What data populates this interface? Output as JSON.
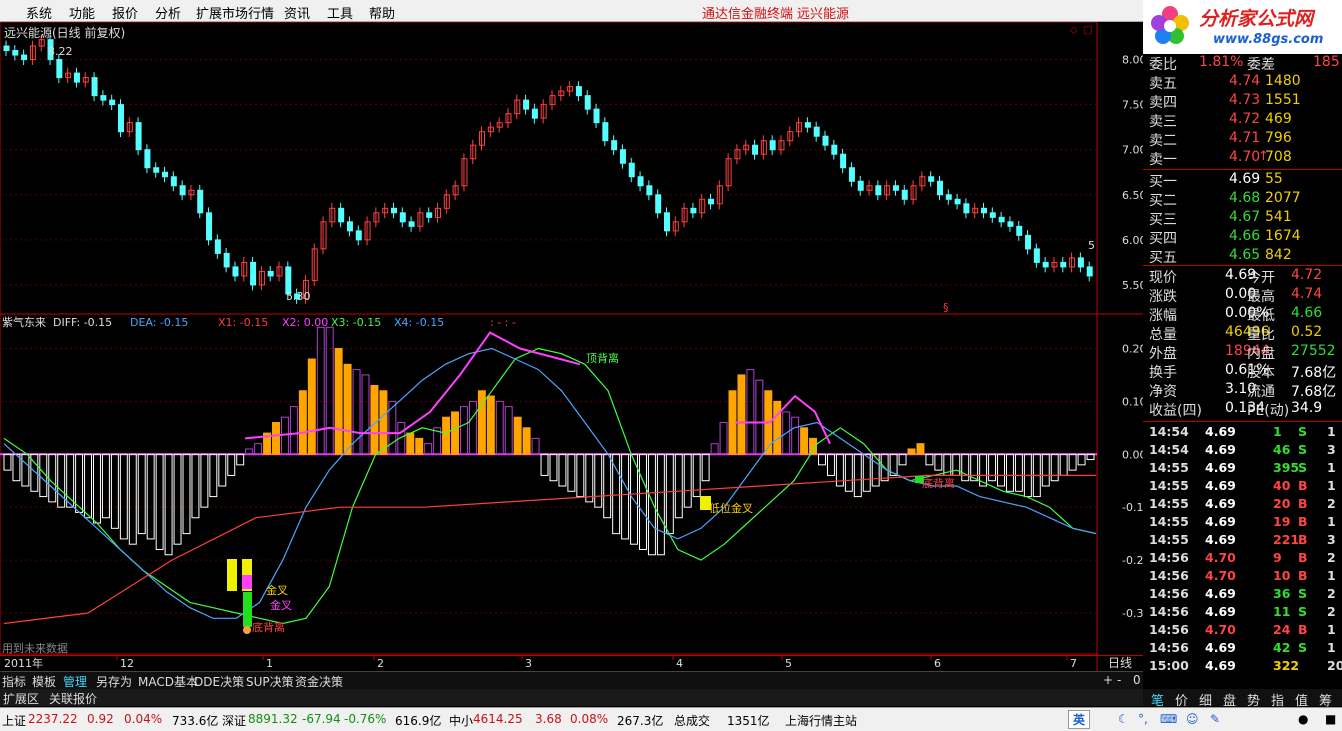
{
  "menu": {
    "items": [
      "系统",
      "功能",
      "报价",
      "分析",
      "扩展市场行情",
      "资讯",
      "工具",
      "帮助"
    ],
    "brand": "通达信金融终端",
    "stock": "远兴能源"
  },
  "logo": {
    "title": "分析家公式网",
    "url": "www.88gs.com"
  },
  "price_panel": {
    "title": "远兴能源(日线 前复权)",
    "high_label": "8.22",
    "low_label": "5.30",
    "y_ticks": [
      "8.00",
      "7.50",
      "7.00",
      "6.50",
      "6.00",
      "5.50"
    ],
    "y_range": [
      5.2,
      8.35
    ],
    "last_mark": "5"
  },
  "indicator_panel": {
    "name": "紫气东来",
    "diff": "DIFF: -0.15",
    "dea": "DEA: -0.15",
    "x1": "X1: -0.15",
    "x2": "X2: 0.00",
    "x3": "X3: -0.15",
    "x4": "X4: -0.15",
    "extra": ": -  : -",
    "y_ticks": [
      "0.20",
      "0.10",
      "0.00",
      "-0.10",
      "-0.20",
      "-0.30"
    ],
    "y_range": [
      -0.37,
      0.25
    ],
    "annotations": {
      "top_div": "顶背离",
      "low_cross": "低位金叉",
      "bottom_div1": "底背离",
      "bottom_div2": "底背离",
      "cross_a": "金叉",
      "cross_b": "金叉",
      "cross_c": "金叉",
      "future": "用到未来数据"
    }
  },
  "timeline": {
    "labels": [
      "2011年",
      "12",
      "1",
      "2",
      "3",
      "4",
      "5",
      "6",
      "7"
    ],
    "period": "日线",
    "zoom": "0"
  },
  "quote": {
    "ratio": {
      "label": "委比",
      "value": "1.81%",
      "label2": "委差",
      "value2": "185"
    },
    "asks": [
      {
        "label": "卖五",
        "price": "4.74",
        "vol": "1480"
      },
      {
        "label": "卖四",
        "price": "4.73",
        "vol": "1551"
      },
      {
        "label": "卖三",
        "price": "4.72",
        "vol": "469"
      },
      {
        "label": "卖二",
        "price": "4.71",
        "vol": "796"
      },
      {
        "label": "卖一",
        "price": "4.70",
        "vol": "708"
      }
    ],
    "bids": [
      {
        "label": "买一",
        "price": "4.69",
        "vol": "55"
      },
      {
        "label": "买二",
        "price": "4.68",
        "vol": "2077"
      },
      {
        "label": "买三",
        "price": "4.67",
        "vol": "541"
      },
      {
        "label": "买四",
        "price": "4.66",
        "vol": "1674"
      },
      {
        "label": "买五",
        "price": "4.65",
        "vol": "842"
      }
    ],
    "stats": [
      {
        "l1": "现价",
        "v1": "4.69",
        "l2": "今开",
        "v2": "4.72",
        "c1": "white",
        "c2": "red"
      },
      {
        "l1": "涨跌",
        "v1": "0.00",
        "l2": "最高",
        "v2": "4.74",
        "c1": "white",
        "c2": "red"
      },
      {
        "l1": "涨幅",
        "v1": "0.00%",
        "l2": "最低",
        "v2": "4.66",
        "c1": "white",
        "c2": "green"
      },
      {
        "l1": "总量",
        "v1": "46496",
        "l2": "量比",
        "v2": "0.52",
        "c1": "yellow",
        "c2": "yellow"
      },
      {
        "l1": "外盘",
        "v1": "18944",
        "l2": "内盘",
        "v2": "27552",
        "c1": "red",
        "c2": "green"
      },
      {
        "l1": "换手",
        "v1": "0.61%",
        "l2": "股本",
        "v2": "7.68亿",
        "c1": "white",
        "c2": "white"
      },
      {
        "l1": "净资",
        "v1": "3.10",
        "l2": "流通",
        "v2": "7.68亿",
        "c1": "white",
        "c2": "white"
      },
      {
        "l1": "收益(四)",
        "v1": "0.134",
        "l2": "PE(动)",
        "v2": "34.9",
        "c1": "white",
        "c2": "white"
      }
    ],
    "ticks": [
      {
        "t": "14:54",
        "p": "4.69",
        "v": "1",
        "s": "S",
        "n": "1",
        "pc": "white",
        "vc": "green"
      },
      {
        "t": "14:54",
        "p": "4.69",
        "v": "46",
        "s": "S",
        "n": "3",
        "pc": "white",
        "vc": "green"
      },
      {
        "t": "14:55",
        "p": "4.69",
        "v": "395",
        "s": "S",
        "n": "1",
        "pc": "white",
        "vc": "green"
      },
      {
        "t": "14:55",
        "p": "4.69",
        "v": "40",
        "s": "B",
        "n": "1",
        "pc": "white",
        "vc": "red"
      },
      {
        "t": "14:55",
        "p": "4.69",
        "v": "20",
        "s": "B",
        "n": "2",
        "pc": "white",
        "vc": "red"
      },
      {
        "t": "14:55",
        "p": "4.69",
        "v": "19",
        "s": "B",
        "n": "1",
        "pc": "white",
        "vc": "red"
      },
      {
        "t": "14:55",
        "p": "4.69",
        "v": "221",
        "s": "B",
        "n": "3",
        "pc": "white",
        "vc": "red"
      },
      {
        "t": "14:56",
        "p": "4.70",
        "v": "9",
        "s": "B",
        "n": "2",
        "pc": "red",
        "vc": "red"
      },
      {
        "t": "14:56",
        "p": "4.70",
        "v": "10",
        "s": "B",
        "n": "1",
        "pc": "red",
        "vc": "red"
      },
      {
        "t": "14:56",
        "p": "4.69",
        "v": "36",
        "s": "S",
        "n": "2",
        "pc": "white",
        "vc": "green"
      },
      {
        "t": "14:56",
        "p": "4.69",
        "v": "11",
        "s": "S",
        "n": "2",
        "pc": "white",
        "vc": "green"
      },
      {
        "t": "14:56",
        "p": "4.70",
        "v": "24",
        "s": "B",
        "n": "1",
        "pc": "red",
        "vc": "red"
      },
      {
        "t": "14:56",
        "p": "4.69",
        "v": "42",
        "s": "S",
        "n": "1",
        "pc": "white",
        "vc": "green"
      },
      {
        "t": "15:00",
        "p": "4.69",
        "v": "322",
        "s": "",
        "n": "20",
        "pc": "white",
        "vc": "yellow"
      }
    ]
  },
  "tabs": [
    "指标",
    "模板",
    "管理",
    "另存为",
    "MACD基本",
    "DDE决策",
    "SUP决策",
    "资金决策"
  ],
  "subtabs": [
    "扩展区",
    "关联报价"
  ],
  "right_tabs": [
    "笔",
    "价",
    "细",
    "盘",
    "势",
    "指",
    "值",
    "筹"
  ],
  "status": {
    "sh_label": "上证",
    "sh_val": "2237.22",
    "sh_chg": "0.92",
    "sh_pct": "0.04%",
    "sh_amt": "733.6亿",
    "sz_label": "深证",
    "sz_val": "8891.32",
    "sz_chg": "-67.94",
    "sz_pct": "-0.76%",
    "sz_amt": "616.9亿",
    "zx_label": "中小",
    "zx_val": "4614.25",
    "zx_chg": "3.68",
    "zx_pct": "0.08%",
    "zx_amt": "267.3亿",
    "total_label": "总成交",
    "total_val": "1351亿",
    "server": "上海行情主站",
    "ime": "英"
  }
}
